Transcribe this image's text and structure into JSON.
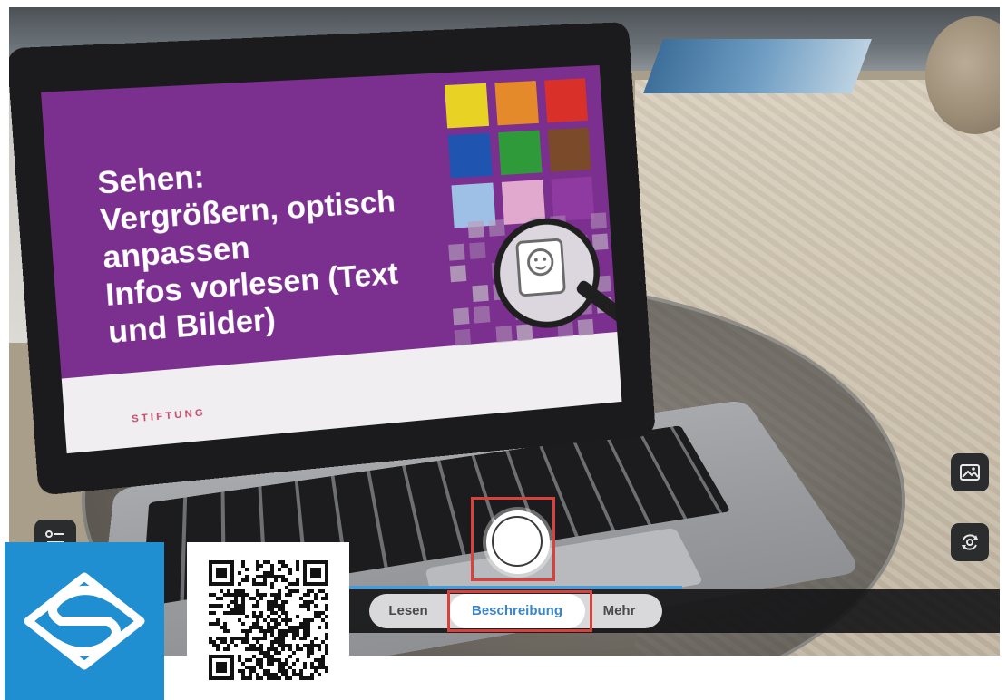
{
  "slide": {
    "text": "Sehen:\nVergrößern, optisch\nanpassen\nInfos vorlesen (Text\nund Bilder)",
    "foundation_logo": "STIFTUNG",
    "swatch_colors": [
      "#e8d324",
      "#e58a2b",
      "#d9302a",
      "#1f54b0",
      "#2e9a3a",
      "#7a4a2a",
      "#9fc0e6",
      "#e2a9cf",
      "#8f3aa0"
    ]
  },
  "controls": {
    "list_icon": "list-settings-icon",
    "gallery_icon": "image-gallery-icon",
    "camera_switch_icon": "camera-switch-icon",
    "shutter_icon": "shutter-icon"
  },
  "modes": {
    "tabs": [
      "Lesen",
      "Beschreibung",
      "Mehr"
    ],
    "selected": "Beschreibung"
  },
  "colors": {
    "accent": "#3a86c9",
    "highlight": "#d9413a",
    "logo_background": "#1f8fd1"
  },
  "overlays": {
    "logo_icon": "app-logo-icon",
    "qr_icon": "qr-code-icon"
  }
}
